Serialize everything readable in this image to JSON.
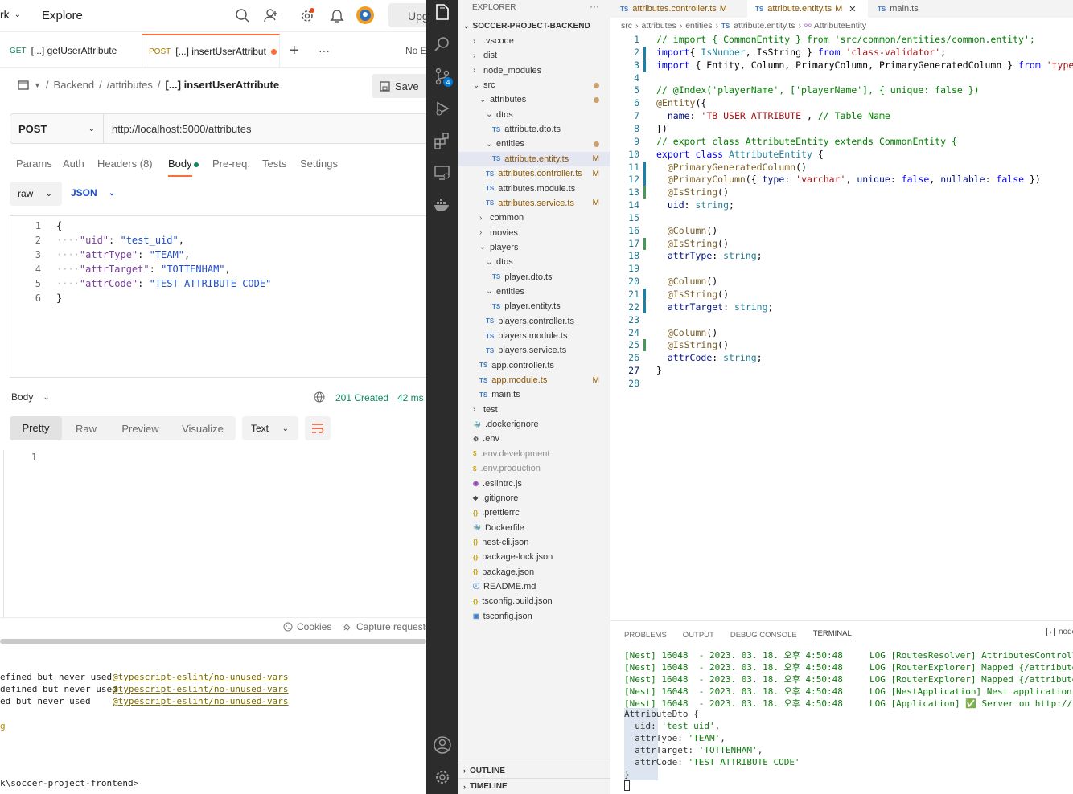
{
  "postman": {
    "workspace_label": "rk",
    "explore": "Explore",
    "upgrade": "Upg",
    "tabs": [
      {
        "method": "GET",
        "label": "[...] getUserAttribute"
      },
      {
        "method": "POST",
        "label": "[...] insertUserAttribut"
      }
    ],
    "no_env": "No E",
    "breadcrumb": {
      "sep": "/",
      "b1": "Backend",
      "b2": "/attributes",
      "current": "[...] insertUserAttribute"
    },
    "save": "Save",
    "method": "POST",
    "url": "http://localhost:5000/attributes",
    "subtabs": [
      "Params",
      "Auth",
      "Headers (8)",
      "Body",
      "Pre-req.",
      "Tests",
      "Settings"
    ],
    "body_mode": "raw",
    "body_lang": "JSON",
    "body_lines": [
      "{",
      "····\"uid\": \"test_uid\",",
      "····\"attrType\": \"TEAM\",",
      "····\"attrTarget\": \"TOTTENHAM\",",
      "····\"attrCode\": \"TEST_ATTRIBUTE_CODE\"",
      "}"
    ],
    "response": {
      "label": "Body",
      "status": "201 Created",
      "time": "42 ms",
      "views": [
        "Pretty",
        "Raw",
        "Preview",
        "Visualize"
      ],
      "format": "Text",
      "line": "1"
    },
    "footer": {
      "cookies": "Cookies",
      "capture": "Capture requests"
    },
    "terminal_lines": [
      [
        "efined but never used",
        "@typescript-eslint/no-unused-vars"
      ],
      [
        "defined but never used",
        "@typescript-eslint/no-unused-vars"
      ],
      [
        "ed but never used",
        "@typescript-eslint/no-unused-vars"
      ]
    ],
    "prompt": "k\\soccer-project-frontend>"
  },
  "vscode": {
    "explorer_title": "EXPLORER",
    "project": "SOCCER-PROJECT-BACKEND",
    "tree": [
      {
        "n": ".vscode",
        "d": 1,
        "t": "folder",
        "o": false
      },
      {
        "n": "dist",
        "d": 1,
        "t": "folder",
        "o": false
      },
      {
        "n": "node_modules",
        "d": 1,
        "t": "folder",
        "o": false
      },
      {
        "n": "src",
        "d": 1,
        "t": "folder",
        "o": true,
        "m": "dot"
      },
      {
        "n": "attributes",
        "d": 2,
        "t": "folder",
        "o": true,
        "m": "dot"
      },
      {
        "n": "dtos",
        "d": 3,
        "t": "folder",
        "o": true
      },
      {
        "n": "attribute.dto.ts",
        "d": 4,
        "t": "ts"
      },
      {
        "n": "entities",
        "d": 3,
        "t": "folder",
        "o": true,
        "m": "dot"
      },
      {
        "n": "attribute.entity.ts",
        "d": 4,
        "t": "ts",
        "m": "M",
        "sel": true
      },
      {
        "n": "attributes.controller.ts",
        "d": 3,
        "t": "ts",
        "m": "M"
      },
      {
        "n": "attributes.module.ts",
        "d": 3,
        "t": "ts"
      },
      {
        "n": "attributes.service.ts",
        "d": 3,
        "t": "ts",
        "m": "M"
      },
      {
        "n": "common",
        "d": 2,
        "t": "folder",
        "o": false
      },
      {
        "n": "movies",
        "d": 2,
        "t": "folder",
        "o": false
      },
      {
        "n": "players",
        "d": 2,
        "t": "folder",
        "o": true
      },
      {
        "n": "dtos",
        "d": 3,
        "t": "folder",
        "o": true
      },
      {
        "n": "player.dto.ts",
        "d": 4,
        "t": "ts"
      },
      {
        "n": "entities",
        "d": 3,
        "t": "folder",
        "o": true
      },
      {
        "n": "player.entity.ts",
        "d": 4,
        "t": "ts"
      },
      {
        "n": "players.controller.ts",
        "d": 3,
        "t": "ts"
      },
      {
        "n": "players.module.ts",
        "d": 3,
        "t": "ts"
      },
      {
        "n": "players.service.ts",
        "d": 3,
        "t": "ts"
      },
      {
        "n": "app.controller.ts",
        "d": 2,
        "t": "ts"
      },
      {
        "n": "app.module.ts",
        "d": 2,
        "t": "ts",
        "m": "M"
      },
      {
        "n": "main.ts",
        "d": 2,
        "t": "ts"
      },
      {
        "n": "test",
        "d": 1,
        "t": "folder",
        "o": false
      },
      {
        "n": ".dockerignore",
        "d": 1,
        "t": "docker"
      },
      {
        "n": ".env",
        "d": 1,
        "t": "gear"
      },
      {
        "n": ".env.development",
        "d": 1,
        "t": "dollar"
      },
      {
        "n": ".env.production",
        "d": 1,
        "t": "dollar"
      },
      {
        "n": ".eslintrc.js",
        "d": 1,
        "t": "eslint"
      },
      {
        "n": ".gitignore",
        "d": 1,
        "t": "git"
      },
      {
        "n": ".prettierrc",
        "d": 1,
        "t": "json"
      },
      {
        "n": "Dockerfile",
        "d": 1,
        "t": "docker"
      },
      {
        "n": "nest-cli.json",
        "d": 1,
        "t": "json"
      },
      {
        "n": "package-lock.json",
        "d": 1,
        "t": "json"
      },
      {
        "n": "package.json",
        "d": 1,
        "t": "json"
      },
      {
        "n": "README.md",
        "d": 1,
        "t": "info"
      },
      {
        "n": "tsconfig.build.json",
        "d": 1,
        "t": "json"
      },
      {
        "n": "tsconfig.json",
        "d": 1,
        "t": "tsconfig"
      }
    ],
    "outline": "OUTLINE",
    "timeline": "TIMELINE",
    "editor_tabs": [
      {
        "label": "attributes.controller.ts",
        "m": "M"
      },
      {
        "label": "attribute.entity.ts",
        "m": "M"
      },
      {
        "label": "main.ts",
        "m": ""
      }
    ],
    "breadcrumb": [
      "src",
      "attributes",
      "entities",
      "attribute.entity.ts",
      "AttributeEntity"
    ],
    "code": [
      [
        [
          "cm",
          "// import { CommonEntity } from 'src/common/entities/common.entity';"
        ]
      ],
      [
        [
          "kw",
          "import"
        ],
        [
          "",
          "{ "
        ],
        [
          "ty",
          "IsNumber"
        ],
        [
          "",
          ", IsString } "
        ],
        [
          "kw",
          "from"
        ],
        [
          "",
          " "
        ],
        [
          "s",
          "'class-validator'"
        ],
        [
          "",
          ";"
        ]
      ],
      [
        [
          "kw",
          "import"
        ],
        [
          "",
          " { Entity, Column, PrimaryColumn, PrimaryGeneratedColumn } "
        ],
        [
          "kw",
          "from"
        ],
        [
          "",
          " "
        ],
        [
          "s",
          "'typeorm'"
        ],
        [
          "",
          ";"
        ]
      ],
      [],
      [
        [
          "cm",
          "// @Index('playerName', ['playerName'], { unique: false })"
        ]
      ],
      [
        [
          "dec",
          "@Entity"
        ],
        [
          "",
          "({"
        ]
      ],
      [
        [
          "",
          ""
        ],
        [
          "pr",
          "  name"
        ],
        [
          "",
          ": "
        ],
        [
          "s",
          "'TB_USER_ATTRIBUTE'"
        ],
        [
          "",
          ", "
        ],
        [
          "cm",
          "// Table Name"
        ]
      ],
      [
        [
          "",
          "})"
        ]
      ],
      [
        [
          "cm",
          "// export class AttributeEntity extends CommonEntity {"
        ]
      ],
      [
        [
          "kw",
          "export"
        ],
        [
          "",
          " "
        ],
        [
          "kw",
          "class"
        ],
        [
          "",
          " "
        ],
        [
          "ty",
          "AttributeEntity"
        ],
        [
          "",
          " {"
        ]
      ],
      [
        [
          "",
          "  "
        ],
        [
          "dec",
          "@PrimaryGeneratedColumn"
        ],
        [
          "",
          "()"
        ]
      ],
      [
        [
          "",
          "  "
        ],
        [
          "dec",
          "@PrimaryColumn"
        ],
        [
          "",
          "({ "
        ],
        [
          "pr",
          "type"
        ],
        [
          "",
          ": "
        ],
        [
          "s",
          "'varchar'"
        ],
        [
          "",
          ", "
        ],
        [
          "pr",
          "unique"
        ],
        [
          "",
          ": "
        ],
        [
          "kw",
          "false"
        ],
        [
          "",
          ", "
        ],
        [
          "pr",
          "nullable"
        ],
        [
          "",
          ": "
        ],
        [
          "kw",
          "false"
        ],
        [
          "",
          " })"
        ]
      ],
      [
        [
          "",
          "  "
        ],
        [
          "dec",
          "@IsString"
        ],
        [
          "",
          "()"
        ]
      ],
      [
        [
          "",
          "  "
        ],
        [
          "pr",
          "uid"
        ],
        [
          "",
          ": "
        ],
        [
          "ty",
          "string"
        ],
        [
          "",
          ";"
        ]
      ],
      [],
      [
        [
          "",
          "  "
        ],
        [
          "dec",
          "@Column"
        ],
        [
          "",
          "()"
        ]
      ],
      [
        [
          "",
          "  "
        ],
        [
          "dec",
          "@IsString"
        ],
        [
          "",
          "()"
        ]
      ],
      [
        [
          "",
          "  "
        ],
        [
          "pr",
          "attrType"
        ],
        [
          "",
          ": "
        ],
        [
          "ty",
          "string"
        ],
        [
          "",
          ";"
        ]
      ],
      [],
      [
        [
          "",
          "  "
        ],
        [
          "dec",
          "@Column"
        ],
        [
          "",
          "()"
        ]
      ],
      [
        [
          "",
          "  "
        ],
        [
          "dec",
          "@IsString"
        ],
        [
          "",
          "()"
        ]
      ],
      [
        [
          "",
          "  "
        ],
        [
          "pr",
          "attrTarget"
        ],
        [
          "",
          ": "
        ],
        [
          "ty",
          "string"
        ],
        [
          "",
          ";"
        ]
      ],
      [],
      [
        [
          "",
          "  "
        ],
        [
          "dec",
          "@Column"
        ],
        [
          "",
          "()"
        ]
      ],
      [
        [
          "",
          "  "
        ],
        [
          "dec",
          "@IsString"
        ],
        [
          "",
          "()"
        ]
      ],
      [
        [
          "",
          "  "
        ],
        [
          "pr",
          "attrCode"
        ],
        [
          "",
          ": "
        ],
        [
          "ty",
          "string"
        ],
        [
          "",
          ";"
        ]
      ],
      [
        [
          "",
          "}"
        ]
      ],
      []
    ],
    "panel_tabs": [
      "PROBLEMS",
      "OUTPUT",
      "DEBUG CONSOLE",
      "TERMINAL"
    ],
    "panel_right": "node",
    "log_lines": [
      [
        "[Nest] 16048  - 2023. 03. 18. 오후 4:50:48     LOG ",
        "[RoutesResolver] AttributesController {/at"
      ],
      [
        "[Nest] 16048  - 2023. 03. 18. 오후 4:50:48     LOG ",
        "[RouterExplorer] Mapped {/attributes, GET}"
      ],
      [
        "[Nest] 16048  - 2023. 03. 18. 오후 4:50:48     LOG ",
        "[RouterExplorer] Mapped {/attributes, POST"
      ],
      [
        "[Nest] 16048  - 2023. 03. 18. 오후 4:50:48     LOG ",
        "[NestApplication] Nest application success"
      ],
      [
        "[Nest] 16048  - 2023. 03. 18. 오후 4:50:48     LOG ",
        "[Application] ✅ Server on http://localhos"
      ]
    ],
    "dto_lines": [
      "AttributeDto {",
      "  uid: 'test_uid',",
      "  attrType: 'TEAM',",
      "  attrTarget: 'TOTTENHAM',",
      "  attrCode: 'TEST_ATTRIBUTE_CODE'",
      "}"
    ]
  }
}
